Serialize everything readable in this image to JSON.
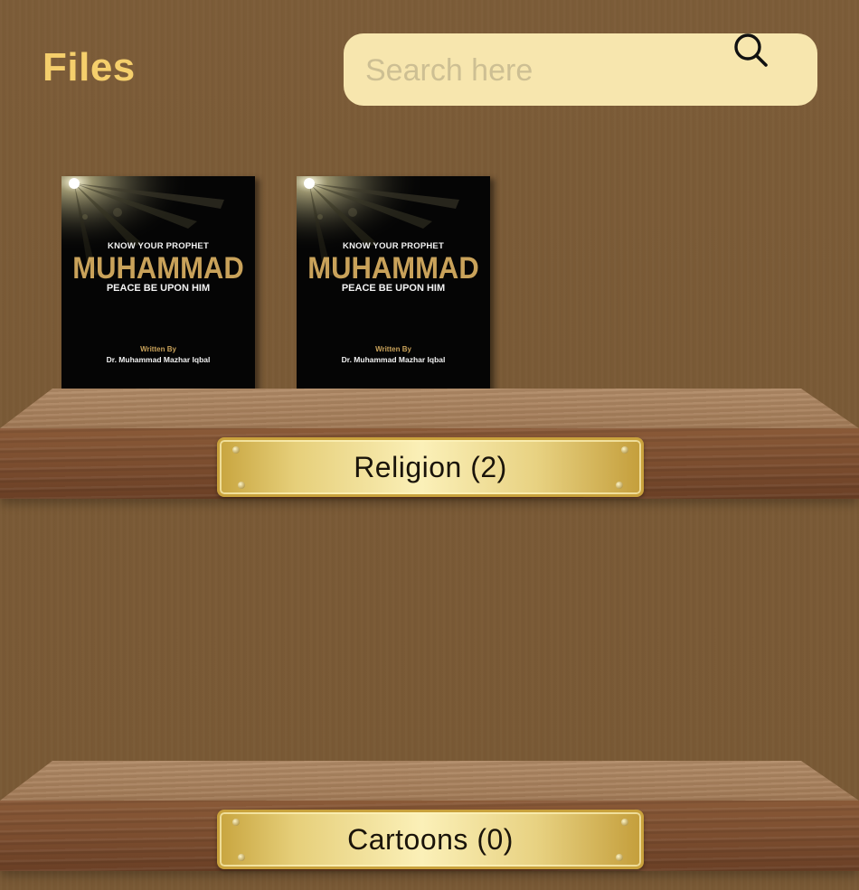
{
  "header": {
    "title": "Files"
  },
  "search": {
    "placeholder": "Search here",
    "icon": "search-icon"
  },
  "shelves": [
    {
      "label": "Religion (2)",
      "books": [
        {
          "pretitle": "KNOW YOUR PROPHET",
          "title": "MUHAMMAD",
          "subtitle": "PEACE BE UPON HIM",
          "byline": "Written By",
          "author": "Dr. Muhammad Mazhar Iqbal"
        },
        {
          "pretitle": "KNOW YOUR PROPHET",
          "title": "MUHAMMAD",
          "subtitle": "PEACE BE UPON HIM",
          "byline": "Written By",
          "author": "Dr. Muhammad Mazhar Iqbal"
        }
      ]
    },
    {
      "label": "Cartoons (0)",
      "books": []
    }
  ],
  "colors": {
    "background": "#7b5b37",
    "title": "#f5cf6c",
    "search_bg": "#f7e6ae",
    "cover_gold": "#c9a25a",
    "plate_gold": "#e6cf7a"
  }
}
